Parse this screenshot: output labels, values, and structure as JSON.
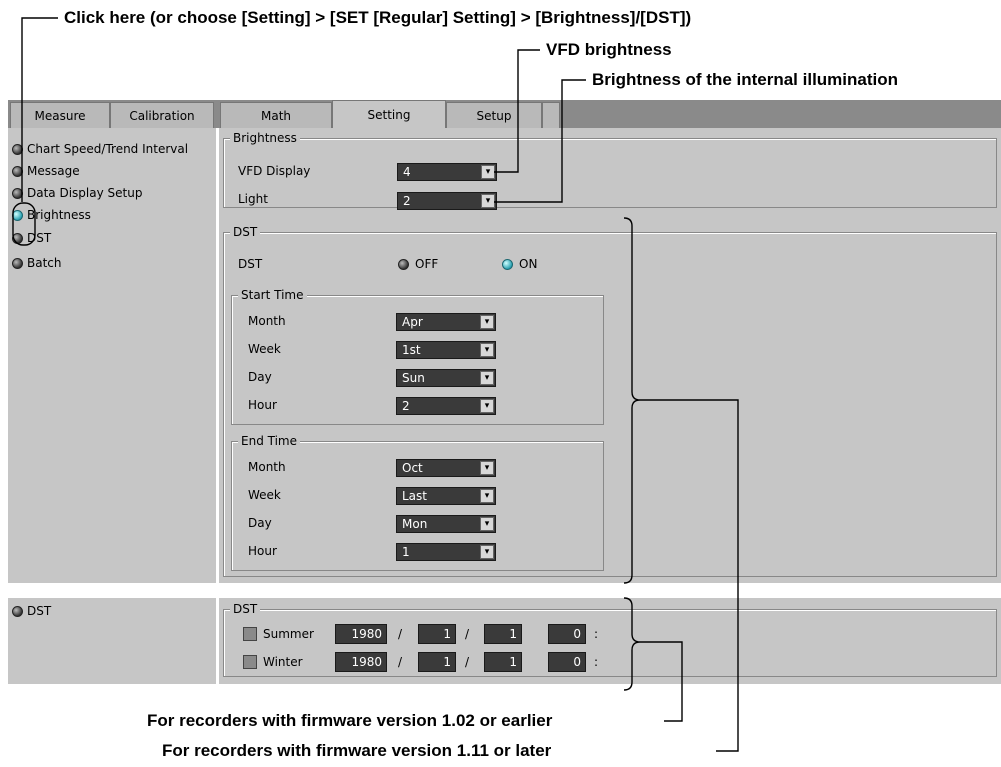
{
  "callouts": {
    "top": "Click here (or choose [Setting] > [SET [Regular] Setting] > [Brightness]/[DST])",
    "vfd": "VFD brightness",
    "illum": "Brightness of the internal illumination",
    "old_fw": "For recorders with firmware version 1.02 or earlier",
    "new_fw": "For recorders with firmware version 1.11 or later"
  },
  "tabs": [
    "Measure",
    "Calibration",
    "Math",
    "Setting",
    "Setup"
  ],
  "sidebar": {
    "items": [
      {
        "label": "Chart Speed/Trend Interval",
        "on": false
      },
      {
        "label": "Message",
        "on": false
      },
      {
        "label": "Data Display Setup",
        "on": false
      },
      {
        "label": "Brightness",
        "on": true
      },
      {
        "label": "DST",
        "on": false
      },
      {
        "label": "Batch",
        "on": false
      }
    ],
    "old_item": "DST"
  },
  "brightness": {
    "title": "Brightness",
    "vfd_label": "VFD Display",
    "vfd_value": "4",
    "light_label": "Light",
    "light_value": "2"
  },
  "dst": {
    "title": "DST",
    "row_label": "DST",
    "off_label": "OFF",
    "on_label": "ON",
    "start": {
      "title": "Start Time",
      "month_label": "Month",
      "month": "Apr",
      "week_label": "Week",
      "week": "1st",
      "day_label": "Day",
      "day": "Sun",
      "hour_label": "Hour",
      "hour": "2"
    },
    "end": {
      "title": "End Time",
      "month_label": "Month",
      "month": "Oct",
      "week_label": "Week",
      "week": "Last",
      "day_label": "Day",
      "day": "Mon",
      "hour_label": "Hour",
      "hour": "1"
    }
  },
  "old_dst": {
    "title": "DST",
    "summer": {
      "label": "Summer",
      "year": "1980",
      "month": "1",
      "day": "1",
      "hour": "0"
    },
    "winter": {
      "label": "Winter",
      "year": "1980",
      "month": "1",
      "day": "1",
      "hour": "0"
    },
    "sep": "/",
    "colon": ":"
  },
  "arrow_glyph": "▾"
}
